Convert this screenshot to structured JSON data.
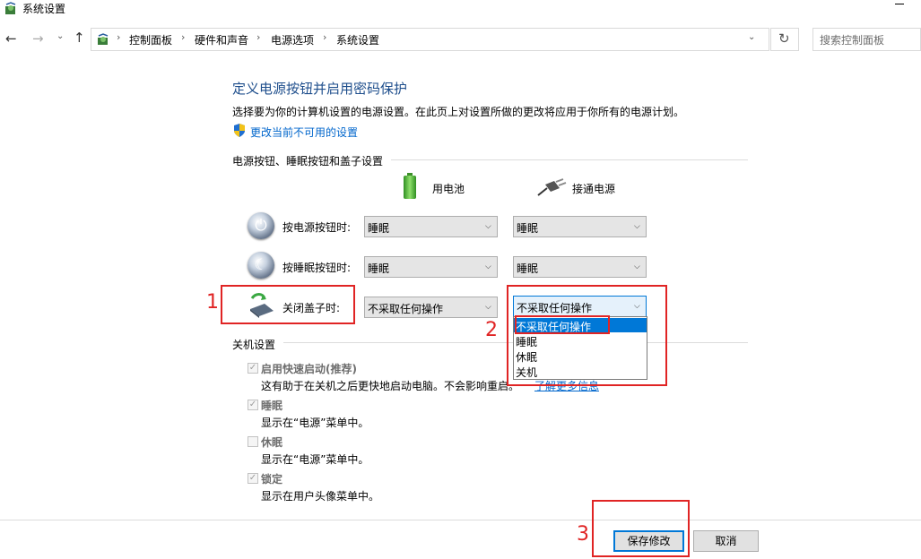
{
  "window": {
    "title": "系统设置"
  },
  "nav": {
    "back_icon": "back-arrow-icon",
    "forward_icon": "forward-arrow-icon",
    "up_icon": "up-arrow-icon",
    "breadcrumb": [
      "控制面板",
      "硬件和声音",
      "电源选项",
      "系统设置"
    ],
    "search_placeholder": "搜索控制面板"
  },
  "main": {
    "title": "定义电源按钮并启用密码保护",
    "description": "选择要为你的计算机设置的电源设置。在此页上对设置所做的更改将应用于你所有的电源计划。",
    "change_link": "更改当前不可用的设置",
    "buttons_section": {
      "heading": "电源按钮、睡眠按钮和盖子设置",
      "col_battery": "用电池",
      "col_ac": "接通电源",
      "rows": [
        {
          "label": "按电源按钮时:",
          "battery": "睡眠",
          "ac": "睡眠",
          "icon": "power-button-icon"
        },
        {
          "label": "按睡眠按钮时:",
          "battery": "睡眠",
          "ac": "睡眠",
          "icon": "sleep-button-icon"
        },
        {
          "label": "关闭盖子时:",
          "battery": "不采取任何操作",
          "ac": "不采取任何操作",
          "icon": "laptop-lid-icon"
        }
      ]
    },
    "dropdown_options": [
      "不采取任何操作",
      "睡眠",
      "休眠",
      "关机"
    ],
    "shutdown_section": {
      "heading": "关机设置",
      "items": [
        {
          "label": "启用快速启动(推荐)",
          "checked": true,
          "desc": "这有助于在关机之后更快地启动电脑。不会影响重启。",
          "link": "了解更多信息"
        },
        {
          "label": "睡眠",
          "checked": true,
          "desc": "显示在“电源”菜单中。"
        },
        {
          "label": "休眠",
          "checked": false,
          "desc": "显示在“电源”菜单中。"
        },
        {
          "label": "锁定",
          "checked": true,
          "desc": "显示在用户头像菜单中。"
        }
      ]
    }
  },
  "footer": {
    "save": "保存修改",
    "cancel": "取消"
  },
  "annotations": [
    "1",
    "2",
    "3"
  ],
  "colors": {
    "title": "#1e4e8c",
    "link": "#0066cc",
    "accent": "#0078d7",
    "annotation": "#e02424"
  }
}
